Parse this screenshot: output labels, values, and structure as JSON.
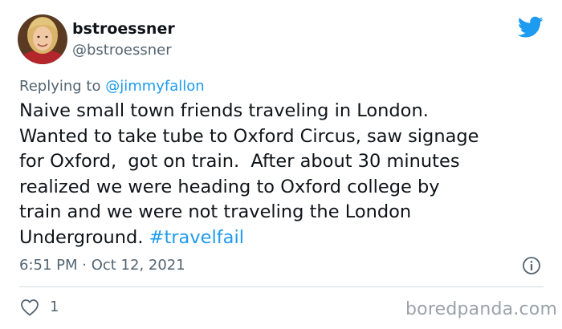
{
  "user": {
    "display_name": "bstroessner",
    "handle": "@bstroessner",
    "avatar_icon": "profile-photo"
  },
  "reply": {
    "prefix": "Replying to ",
    "mention": "@jimmyfallon"
  },
  "tweet": {
    "lines": [
      "Naive small town friends traveling in London.",
      "Wanted to take tube to Oxford Circus, saw signage",
      "for Oxford,  got on train.  After about 30 minutes",
      "realized we were heading to Oxford college by",
      "train and we were not traveling the London"
    ],
    "last_line_text": "Underground. ",
    "hashtag": "#travelfail"
  },
  "meta": {
    "timestamp": "6:51 PM · Oct 12, 2021",
    "like_count": "1"
  },
  "icons": {
    "brand": "twitter-bird-icon",
    "info": "info-icon",
    "like": "heart-icon"
  },
  "watermark": "boredpanda.com",
  "colors": {
    "accent": "#1d9bf0",
    "text": "#0f1419",
    "muted": "#536471",
    "divider": "#cfd9de",
    "watermark": "#9aa3aa"
  }
}
